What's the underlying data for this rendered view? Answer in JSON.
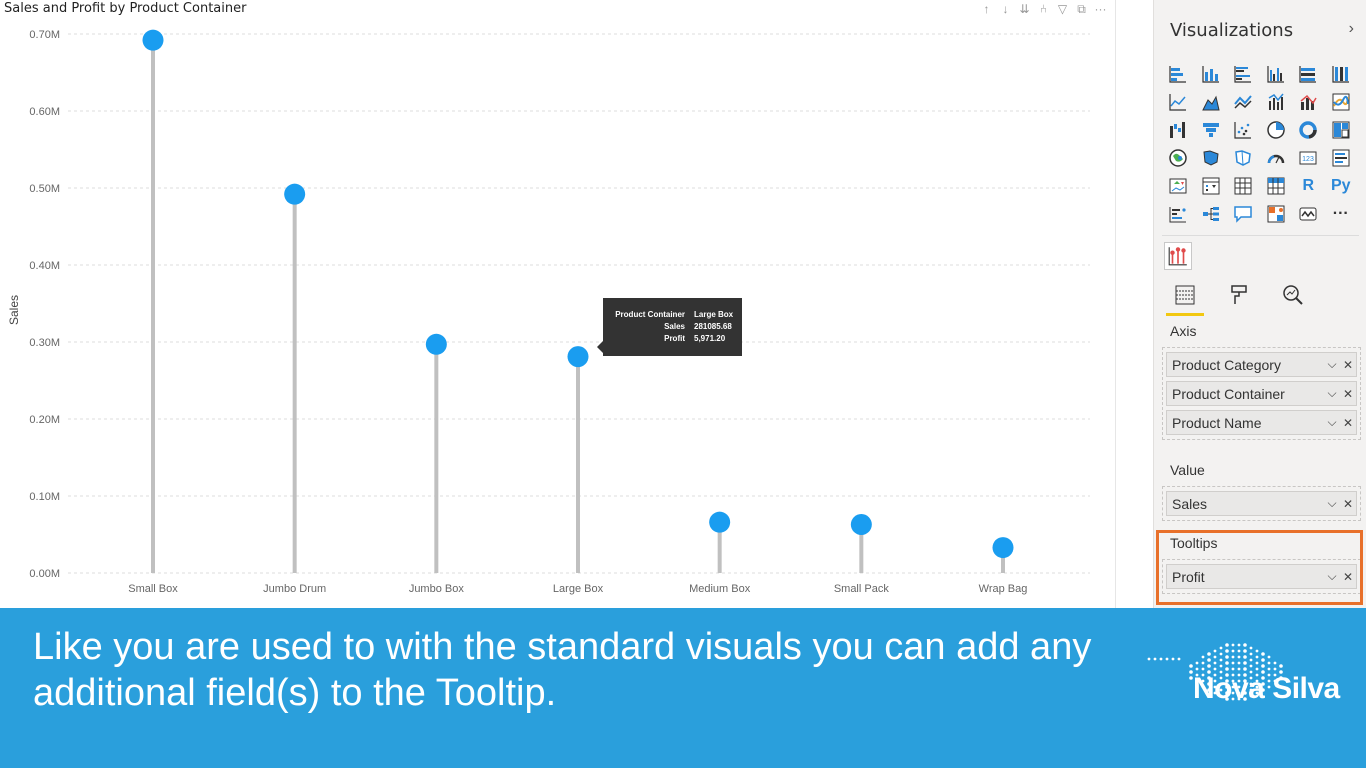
{
  "visual": {
    "title": "Sales and Profit by Product Container",
    "header_icons": [
      "arrow-up-icon",
      "arrow-down-icon",
      "double-arrow-down-icon",
      "fork-icon",
      "filter-icon",
      "focus-mode-icon",
      "more-options-icon"
    ]
  },
  "chart_data": {
    "type": "lollipop",
    "title": "Sales and Profit by Product Container",
    "ylabel": "Sales",
    "xlabel": "",
    "ylim": [
      0,
      0.7
    ],
    "y_unit": "M",
    "y_ticks": [
      "0.00M",
      "0.10M",
      "0.20M",
      "0.30M",
      "0.40M",
      "0.50M",
      "0.60M",
      "0.70M"
    ],
    "y_tick_values": [
      0,
      0.1,
      0.2,
      0.3,
      0.4,
      0.5,
      0.6,
      0.7
    ],
    "grid": true,
    "categories": [
      "Small Box",
      "Jumbo Drum",
      "Jumbo Box",
      "Large Box",
      "Medium Box",
      "Small Pack",
      "Wrap Bag"
    ],
    "series": [
      {
        "values": [
          0.692,
          0.492,
          0.297,
          0.281,
          0.066,
          0.063,
          0.033
        ]
      }
    ],
    "marker_color": "#1a9df0",
    "stem_color": "#c0c0c0"
  },
  "tooltip": {
    "rows": [
      {
        "key": "Product Container",
        "value": "Large Box"
      },
      {
        "key": "Sales",
        "value": "281085.68"
      },
      {
        "key": "Profit",
        "value": "5,971.20"
      }
    ]
  },
  "pane": {
    "title": "Visualizations",
    "collapse_icon": "chevron-right-icon",
    "tabs": [
      "fields-tab-icon",
      "format-paint-roller-icon",
      "analytics-magnifier-icon"
    ],
    "wells": {
      "axis": {
        "label": "Axis",
        "fields": [
          "Product Category",
          "Product Container",
          "Product Name"
        ]
      },
      "value": {
        "label": "Value",
        "fields": [
          "Sales"
        ]
      },
      "tooltips": {
        "label": "Tooltips",
        "fields": [
          "Profit"
        ]
      }
    },
    "r_label": "R",
    "py_label": "Py",
    "card_label": "123",
    "more_label": "···"
  },
  "banner": {
    "text": "Like you are used to with the standard visuals you can add any additional field(s) to the Tooltip.",
    "logo_text": "Nova Silva",
    "background": "#2a9fdc"
  }
}
